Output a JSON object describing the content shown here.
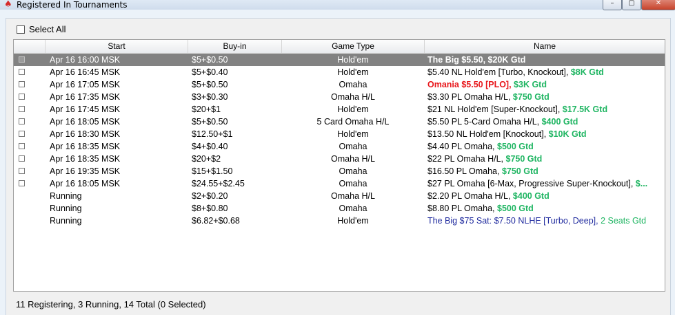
{
  "window": {
    "title": "Registered In Tournaments",
    "minimize_label": "–",
    "maximize_label": "▢",
    "close_label": "✕"
  },
  "select_all_label": "Select All",
  "columns": {
    "start": "Start",
    "buyin": "Buy-in",
    "game": "Game Type",
    "name": "Name"
  },
  "rows": [
    {
      "start": "Apr 16  16:00 MSK",
      "buyin": "$5+$0.50",
      "game": "Hold'em",
      "name": "The Big $5.50, $20K Gtd",
      "gtd": "",
      "selected": true,
      "checkbox": true,
      "style": "bold"
    },
    {
      "start": "Apr 16  16:45 MSK",
      "buyin": "$5+$0.40",
      "game": "Hold'em",
      "name": "$5.40 NL Hold'em [Turbo, Knockout], ",
      "gtd": "$8K Gtd",
      "checkbox": true,
      "style": "normal"
    },
    {
      "start": "Apr 16  17:05 MSK",
      "buyin": "$5+$0.50",
      "game": "Omaha",
      "name": "Omania $5.50 [PLO], ",
      "gtd": "$3K Gtd",
      "checkbox": true,
      "style": "red"
    },
    {
      "start": "Apr 16  17:35 MSK",
      "buyin": "$3+$0.30",
      "game": "Omaha H/L",
      "name": "$3.30 PL Omaha H/L, ",
      "gtd": "$750 Gtd",
      "checkbox": true,
      "style": "normal"
    },
    {
      "start": "Apr 16  17:45 MSK",
      "buyin": "$20+$1",
      "game": "Hold'em",
      "name": "$21 NL Hold'em [Super-Knockout], ",
      "gtd": "$17.5K Gtd",
      "checkbox": true,
      "style": "normal"
    },
    {
      "start": "Apr 16  18:05 MSK",
      "buyin": "$5+$0.50",
      "game": "5 Card Omaha H/L",
      "name": "$5.50 PL 5-Card Omaha H/L, ",
      "gtd": "$400 Gtd",
      "checkbox": true,
      "style": "normal"
    },
    {
      "start": "Apr 16  18:30 MSK",
      "buyin": "$12.50+$1",
      "game": "Hold'em",
      "name": "$13.50 NL Hold'em [Knockout], ",
      "gtd": "$10K Gtd",
      "checkbox": true,
      "style": "normal"
    },
    {
      "start": "Apr 16  18:35 MSK",
      "buyin": "$4+$0.40",
      "game": "Omaha",
      "name": "$4.40 PL Omaha, ",
      "gtd": "$500 Gtd",
      "checkbox": true,
      "style": "normal"
    },
    {
      "start": "Apr 16  18:35 MSK",
      "buyin": "$20+$2",
      "game": "Omaha H/L",
      "name": "$22 PL Omaha H/L, ",
      "gtd": "$750 Gtd",
      "checkbox": true,
      "style": "normal"
    },
    {
      "start": "Apr 16  19:35 MSK",
      "buyin": "$15+$1.50",
      "game": "Omaha",
      "name": "$16.50 PL Omaha, ",
      "gtd": "$750 Gtd",
      "checkbox": true,
      "style": "normal"
    },
    {
      "start": "Apr 16  18:05 MSK",
      "buyin": "$24.55+$2.45",
      "game": "Omaha",
      "name": "$27 PL Omaha [6-Max, Progressive Super-Knockout], ",
      "gtd": "$...",
      "checkbox": true,
      "style": "normal"
    },
    {
      "start": "Running",
      "buyin": "$2+$0.20",
      "game": "Omaha H/L",
      "name": "$2.20 PL Omaha H/L, ",
      "gtd": "$400 Gtd",
      "checkbox": false,
      "style": "normal"
    },
    {
      "start": "Running",
      "buyin": "$8+$0.80",
      "game": "Omaha",
      "name": "$8.80 PL Omaha, ",
      "gtd": "$500 Gtd",
      "checkbox": false,
      "style": "normal"
    },
    {
      "start": "Running",
      "buyin": "$6.82+$0.68",
      "game": "Hold'em",
      "name": "The Big $75 Sat: $7.50 NLHE [Turbo, Deep], ",
      "gtd": "2 Seats Gtd",
      "checkbox": false,
      "style": "blue"
    }
  ],
  "status": "11 Registering, 3 Running, 14 Total (0 Selected)",
  "colors": {
    "selected_row": "#828282",
    "gtd_green": "#1fb562",
    "highlight_red": "#e8171b",
    "satellite_blue": "#1f2a9e"
  }
}
